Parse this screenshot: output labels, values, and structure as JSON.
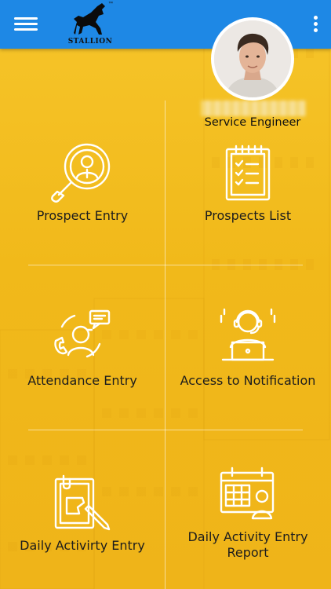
{
  "app": {
    "brand_logo_text": "STALLION",
    "trademark": "™"
  },
  "profile": {
    "role": "Service Engineer"
  },
  "menu": [
    {
      "label": "Prospect Entry",
      "icon": "search-user-icon"
    },
    {
      "label": "Prospects List",
      "icon": "clipboard-list-icon"
    },
    {
      "label": "Attendance Entry",
      "icon": "call-support-icon"
    },
    {
      "label": "Access to Notification",
      "icon": "headset-laptop-icon"
    },
    {
      "label": "Daily Activirty Entry",
      "icon": "document-edit-icon"
    },
    {
      "label": "Daily Activity Entry Report",
      "icon": "calendar-user-icon"
    }
  ],
  "colors": {
    "topbar": "#1e88e5",
    "background": "#f2bb1c",
    "icon_stroke": "#ffffff"
  }
}
